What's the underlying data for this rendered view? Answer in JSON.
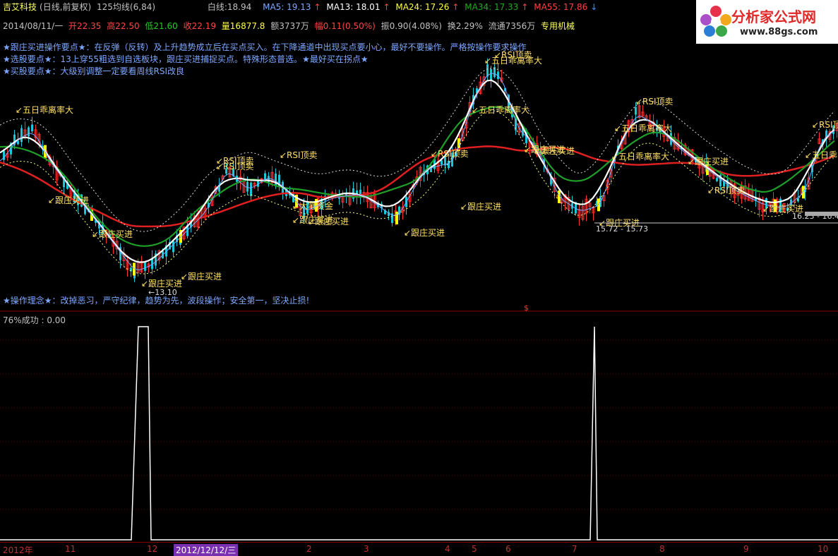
{
  "header": {
    "stock_name": "吉艾科技",
    "period_info": "(日线,前复权)",
    "indicator_name": "125均线(6,84)",
    "baseline_label": "白线:",
    "baseline_value": "18.94",
    "ma5": "MA5: 19.13",
    "ma13": "MA13: 18.01",
    "ma24": "MA24: 17.26",
    "ma34": "MA34: 17.33",
    "ma55": "MA55: 17.86"
  },
  "quote": {
    "date": "2014/08/11/一",
    "open": "开22.35",
    "high": "高22.50",
    "low": "低21.60",
    "close": "收22.19",
    "volume": "量16877.8",
    "amount": "额3737万",
    "change": "幅0.11(0.50%)",
    "amplitude": "振0.90(4.08%)",
    "turnover": "换2.29%",
    "float": "流通7356万",
    "sector": "专用机械"
  },
  "notes": [
    "★跟庄买进操作要点★：在反弹（反转）及上升趋势成立后在买点买入。在下降通道中出现买点要小心，最好不要操作。严格按操作要求操作",
    "★选股要点★：13上穿55粗选到自选板块，跟庄买进捕捉买点。特殊形态普选。★最好买在拐点★",
    "★买股要点★：大级别调整一定要看周线RSI改良",
    "★操作理念★：改掉恶习，严守纪律，趋势为先，波段操作；安全第一，坚决止损!"
  ],
  "colors": {
    "ma_white": "#ffffff",
    "ma_green": "#1f9e2a",
    "ma_red": "#e02020",
    "candle_up": "#ff3030",
    "candle_down": "#19c8d8",
    "signal_yellow": "#ffff00",
    "annotation": "#ffe066"
  },
  "signals": [
    "五日乖离率大",
    "跟庄买进",
    "跟庄买进",
    "跟庄买进",
    "RSI顶卖",
    "RSI顶卖",
    "RSI顶卖",
    "大笔资金",
    "跟庄买进",
    "跟庄买进",
    "跟庄买进",
    "RSI顶卖",
    "五日乖离率大",
    "五日乖离率大",
    "跟庄买进",
    "跟庄买进",
    "五日乖离率大",
    "RSI顶卖",
    "五日乖离率大",
    "跟庄买进",
    "跟庄买进",
    "五日乖",
    "RSI顶卖",
    "RSI顶卖",
    "跟庄买进",
    "RSI顶卖",
    "跟庄买进",
    "跟庄买进"
  ],
  "price_marks": [
    "13.10",
    "15.72 - 15.73",
    "16.23 - 16.4"
  ],
  "lower_panel": {
    "label": "76%成功 : 0.00"
  },
  "time_axis": [
    "2012年",
    "11",
    "12",
    "2012/12/12/三",
    "2",
    "3",
    "4",
    "5",
    "6",
    "7",
    "8",
    "9",
    "10"
  ],
  "logo": {
    "brand": "分析家公式网",
    "url": "www.88gs.com"
  }
}
